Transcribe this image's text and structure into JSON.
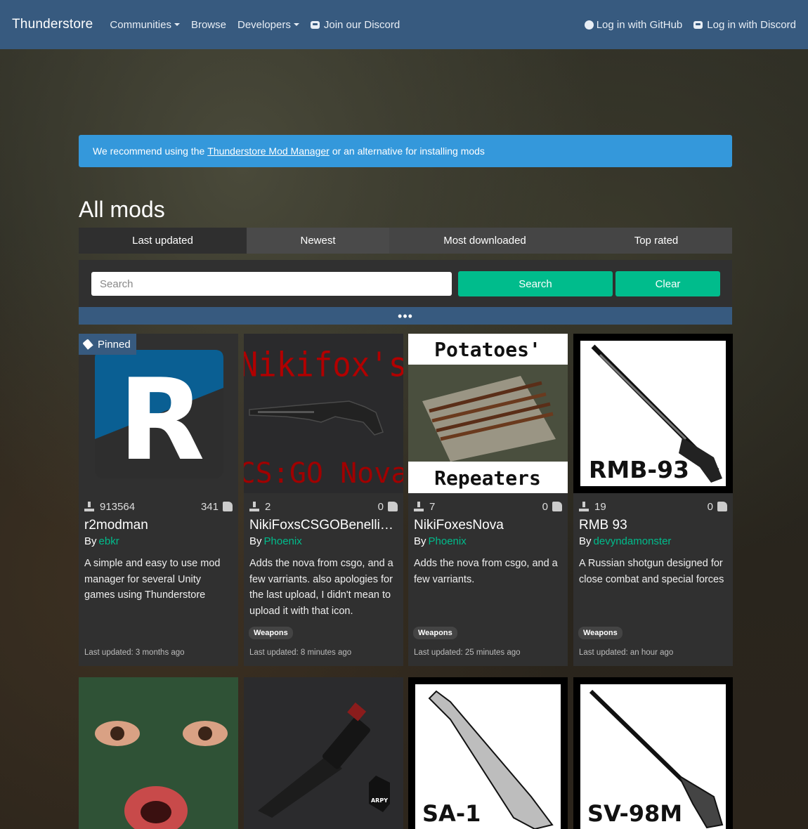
{
  "navbar": {
    "brand": "Thunderstore",
    "items": [
      {
        "label": "Communities",
        "dropdown": true
      },
      {
        "label": "Browse",
        "dropdown": false
      },
      {
        "label": "Developers",
        "dropdown": true
      },
      {
        "label": "Join our Discord",
        "icon": "discord-icon"
      }
    ],
    "login_github": "Log in with GitHub",
    "login_discord": "Log in with Discord"
  },
  "alert": {
    "prefix": "We recommend using the",
    "link": "Thunderstore Mod Manager",
    "suffix": "or an alternative for installing mods"
  },
  "page_title": "All mods",
  "tabs": [
    "Last updated",
    "Newest",
    "Most downloaded",
    "Top rated"
  ],
  "search": {
    "placeholder": "Search",
    "search_button": "Search",
    "clear_button": "Clear",
    "expand_label": "•••"
  },
  "colors": {
    "navbar": "#375a7f",
    "alert": "#3498db",
    "accent": "#00bc8c",
    "card": "#303030"
  },
  "cards": [
    {
      "pinned_label": "Pinned",
      "image_letter": "R",
      "downloads": "913564",
      "likes": "341",
      "name": "r2modman",
      "by": "By",
      "author": "ebkr",
      "description": "A simple and easy to use mod manager for several Unity games using Thunderstore",
      "tag": "",
      "updated": "Last updated: 3 months ago"
    },
    {
      "image_top": "Nikifox's",
      "image_bottom": "CS:GO Nova",
      "downloads": "2",
      "likes": "0",
      "name": "NikiFoxsCSGOBenelliN...",
      "by": "By",
      "author": "Phoenix",
      "description": "Adds the nova from csgo, and a few varriants. also apologies for the last upload, I didn't mean to upload it with that icon.",
      "tag": "Weapons",
      "updated": "Last updated: 8 minutes ago"
    },
    {
      "image_top": "Potatoes'",
      "image_bottom": "Repeaters",
      "downloads": "7",
      "likes": "0",
      "name": "NikiFoxesNova",
      "by": "By",
      "author": "Phoenix",
      "description": "Adds the nova from csgo, and a few varriants.",
      "tag": "Weapons",
      "updated": "Last updated: 25 minutes ago"
    },
    {
      "image_label": "RMB-93",
      "downloads": "19",
      "likes": "0",
      "name": "RMB 93",
      "by": "By",
      "author": "devyndamonster",
      "description": "A Russian shotgun designed for close combat and special forces",
      "tag": "Weapons",
      "updated": "Last updated: an hour ago"
    }
  ],
  "second_row": [
    {
      "kind": "mask-face"
    },
    {
      "kind": "knife",
      "badge": "ARPY"
    },
    {
      "kind": "rifle",
      "image_label": "SA-1"
    },
    {
      "kind": "rifle",
      "image_label": "SV-98M"
    }
  ]
}
